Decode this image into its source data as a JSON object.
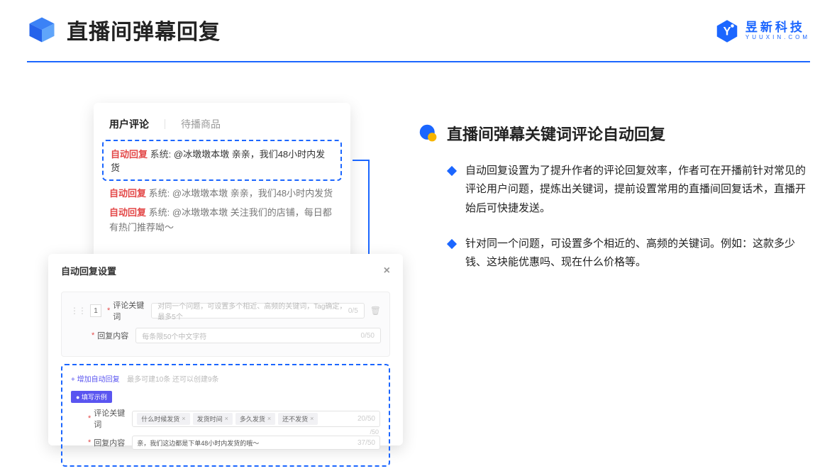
{
  "header": {
    "page_title": "直播间弹幕回复",
    "brand_cn": "昱新科技",
    "brand_en": "YUUXIN.COM"
  },
  "right": {
    "section_title": "直播间弹幕关键词评论自动回复",
    "bullets": [
      "自动回复设置为了提升作者的评论回复效率，作者可在开播前针对常见的评论用户问题，提炼出关键词，提前设置常用的直播间回复话术，直播开始后可快捷发送。",
      "针对同一个问题，可设置多个相近的、高频的关键词。例如：这款多少钱、这块能优惠吗、现在什么价格等。"
    ]
  },
  "comments_panel": {
    "tab_active": "用户评论",
    "tab_inactive": "待播商品",
    "auto_label": "自动回复",
    "sys_label": "系统:",
    "highlight_text": "@冰墩墩本墩 亲亲，我们48小时内发货",
    "line2_text": "@冰墩墩本墩 亲亲，我们48小时内发货",
    "line3_text": "@冰墩墩本墩 关注我们的店铺，每日都有热门推荐呦～"
  },
  "settings_panel": {
    "title": "自动回复设置",
    "idx": "1",
    "row1_label": "评论关键词",
    "row1_placeholder": "对同一个问题，可设置多个相近、高频的关键词，Tag确定，最多5个",
    "row1_counter": "0/5",
    "row2_label": "回复内容",
    "row2_placeholder": "每条限50个中文字符",
    "row2_counter": "0/50",
    "add_link": "+ 增加自动回复",
    "add_hint": "最多可建10条 还可以创建9条",
    "badge": "● 填写示例",
    "ex_row1_label": "评论关键词",
    "ex_tags": [
      "什么时候发货",
      "发货时间",
      "多久发货",
      "还不发货"
    ],
    "ex_row1_counter": "20/50",
    "ex_row2_label": "回复内容",
    "ex_row2_value": "亲，我们这边都是下单48小时内发货的哦～",
    "ex_row2_counter": "37/50",
    "trailing_counter": "/50"
  }
}
